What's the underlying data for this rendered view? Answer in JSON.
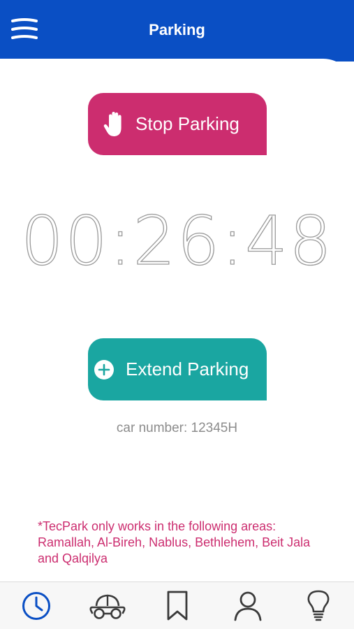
{
  "header": {
    "title": "Parking",
    "menu_icon": "hamburger-menu-icon"
  },
  "stop_button": {
    "label": "Stop Parking",
    "icon": "hand-stop-icon",
    "color": "#cc2d6f"
  },
  "timer": {
    "value": "00:26:48"
  },
  "extend_button": {
    "label": "Extend Parking",
    "icon": "plus-circle-icon",
    "color": "#1aa6a1"
  },
  "car_number": "car number: 12345H",
  "notice": "*TecPark only works in the following areas: Ramallah, Al-Bireh, Nablus, Bethlehem, Beit Jala and Qalqilya",
  "tabbar": {
    "items": [
      {
        "icon": "clock-icon",
        "active": true
      },
      {
        "icon": "car-icon",
        "active": false
      },
      {
        "icon": "bookmark-icon",
        "active": false
      },
      {
        "icon": "user-icon",
        "active": false
      },
      {
        "icon": "lightbulb-icon",
        "active": false
      }
    ],
    "active_color": "#0a4fc4",
    "inactive_color": "#3a3a3a"
  },
  "colors": {
    "brand": "#0a4fc4",
    "stop": "#cc2d6f",
    "extend": "#1aa6a1"
  }
}
